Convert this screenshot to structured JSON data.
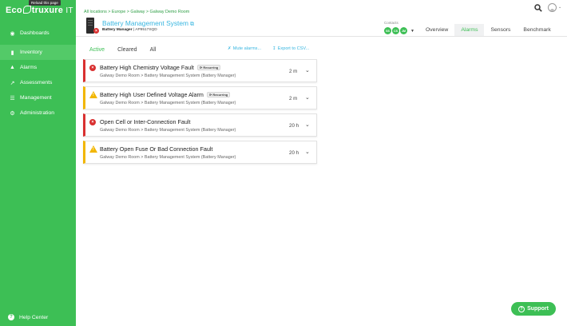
{
  "sidebar": {
    "reload_tip": "Reload this page",
    "logo": {
      "part1": "Eco",
      "part2": "truxure",
      "part3": "IT"
    },
    "items": [
      {
        "label": "Dashboards",
        "icon": "dashboard-icon"
      },
      {
        "label": "Inventory",
        "icon": "inventory-icon",
        "active": true
      },
      {
        "label": "Alarms",
        "icon": "warning-icon"
      },
      {
        "label": "Assessments",
        "icon": "chart-icon"
      },
      {
        "label": "Management",
        "icon": "list-icon"
      },
      {
        "label": "Administration",
        "icon": "gear-icon"
      }
    ],
    "help": "Help Center",
    "help_icon": "question-icon"
  },
  "header": {
    "breadcrumb": "All locations > Europe > Galway > Galway Demo Room",
    "device_title": "Battery Management System",
    "device_type": "Battery Manager",
    "device_id": "| AP9517SQD",
    "contacts_label": "Contacts",
    "contacts": [
      "SS",
      "CS",
      "JM"
    ],
    "tabs": [
      {
        "label": "Overview"
      },
      {
        "label": "Alarms",
        "active": true
      },
      {
        "label": "Sensors"
      },
      {
        "label": "Benchmark"
      }
    ]
  },
  "alarm_view": {
    "tabs": [
      {
        "label": "Active",
        "active": true
      },
      {
        "label": "Cleared"
      },
      {
        "label": "All"
      }
    ],
    "mute_label": "Mute alarms...",
    "export_label": "Export to CSV..."
  },
  "alarms": [
    {
      "severity": "critical",
      "title": "Battery High Chemistry Voltage Fault",
      "recurring": "Recurring",
      "path": "Galway Demo Room > Battery Management System (Battery Manager)",
      "time": "2 m"
    },
    {
      "severity": "warning",
      "title": "Battery High User Defined Voltage Alarm",
      "recurring": "Recurring",
      "path": "Galway Demo Room > Battery Management System (Battery Manager)",
      "time": "2 m"
    },
    {
      "severity": "critical",
      "title": "Open Cell or Inter-Connection Fault",
      "path": "Galway Demo Room > Battery Management System (Battery Manager)",
      "time": "20 h"
    },
    {
      "severity": "warning",
      "title": "Battery Open Fuse Or Bad Connection Fault",
      "path": "Galway Demo Room > Battery Management System (Battery Manager)",
      "time": "20 h"
    }
  ],
  "support_label": "Support",
  "colors": {
    "brand_green": "#3dbf55",
    "link_blue": "#38b6e0",
    "critical": "#d93030",
    "warning": "#f2b600"
  }
}
